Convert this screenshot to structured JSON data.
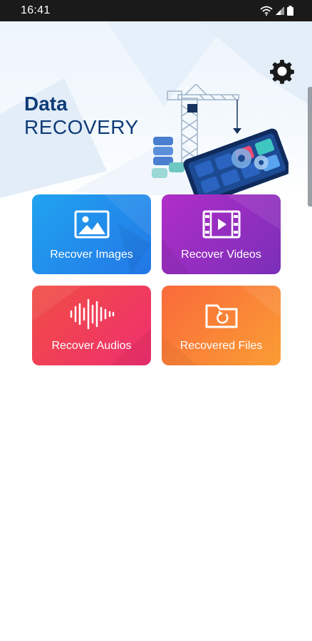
{
  "status_bar": {
    "time": "16:41",
    "icons": [
      "wifi-icon",
      "signal-icon",
      "battery-icon"
    ]
  },
  "header": {
    "title_line1": "Data",
    "title_line2": "RECOVERY",
    "settings_icon": "gear-icon",
    "title_color": "#0f3b78"
  },
  "tiles": [
    {
      "label": "Recover Images",
      "icon": "image-icon",
      "color": "#2277e6"
    },
    {
      "label": "Recover Videos",
      "icon": "video-icon",
      "color": "#9a2fc2"
    },
    {
      "label": "Recover Audios",
      "icon": "audio-wave-icon",
      "color": "#ef3a5a"
    },
    {
      "label": "Recovered Files",
      "icon": "folder-restore-icon",
      "color": "#f9823a"
    }
  ]
}
